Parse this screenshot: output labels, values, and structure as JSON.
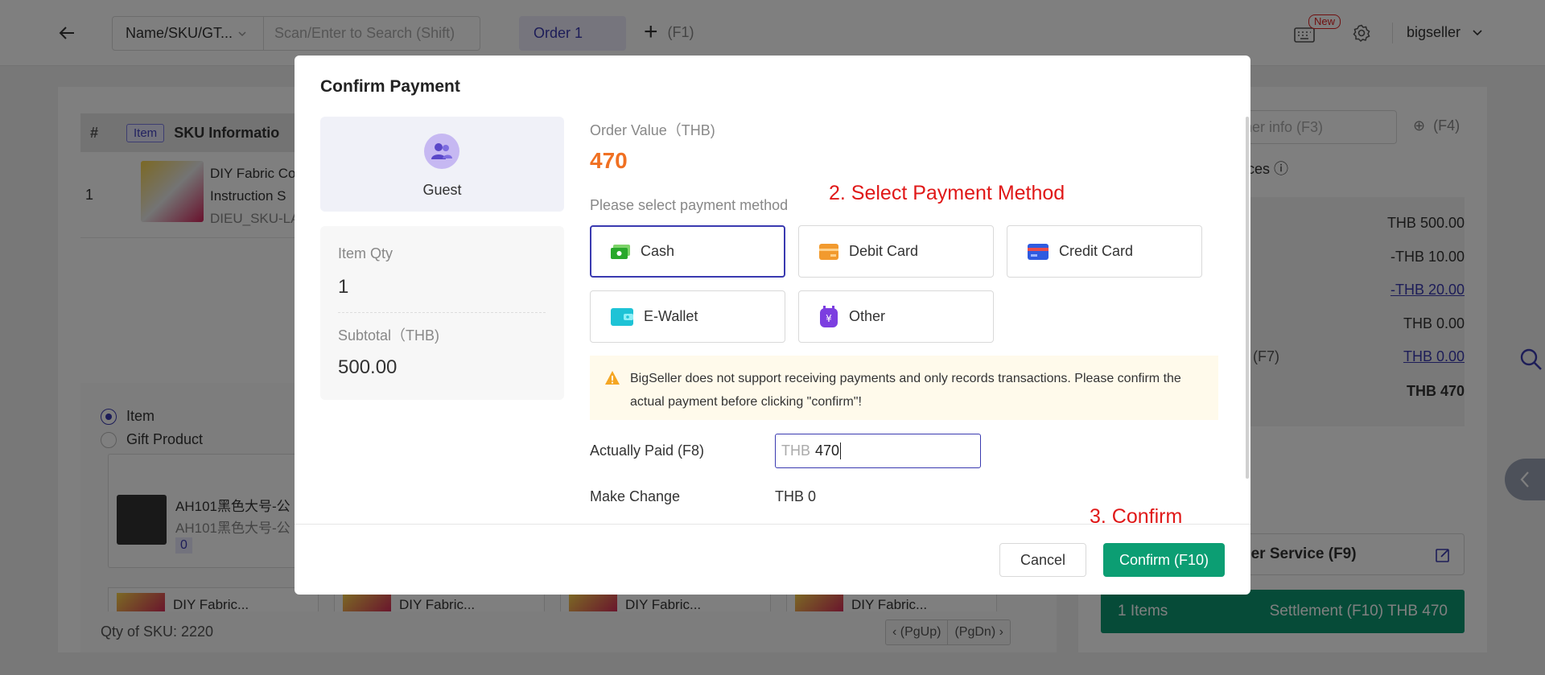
{
  "topbar": {
    "search_type": "Name/SKU/GT...",
    "search_placeholder": "Scan/Enter to Search (Shift)",
    "order_tab": "Order 1",
    "add_order_shortcut": "(F1)",
    "new_badge": "New",
    "username": "bigseller"
  },
  "table": {
    "hash": "#",
    "item_tag": "Item",
    "sku_header": "SKU Informatio",
    "row_number": "1",
    "product_name_1": "DIY Fabric Co",
    "product_name_2": "Instruction S",
    "product_sku": "DIEU_SKU-LA"
  },
  "product_panel": {
    "radio_item": "Item",
    "radio_gift": "Gift Product",
    "card_title": "AH101黑色大号-公",
    "card_subtitle": "AH101黑色大号-公",
    "card_qty": "0",
    "mini_cards": [
      "DIY Fabric...",
      "DIY Fabric...",
      "DIY Fabric...",
      "DIY Fabric..."
    ],
    "qty_of_sku": "Qty of SKU: 2220",
    "pager_up": "(PgUp)",
    "pager_down": "(PgDn)"
  },
  "right_panel": {
    "customer_placeholder": "ner info (F3)",
    "add_shortcut": "(F4)",
    "services_label": "ices",
    "summary": [
      "THB 500.00",
      "-THB 10.00",
      "-THB 20.00",
      "THB 0.00",
      "THB 0.00",
      "THB 470"
    ],
    "f7_label": ") (F7)",
    "service_button": "ner Service (F9)",
    "items_count": "1 Items",
    "settlement": "Settlement (F10) THB 470"
  },
  "modal": {
    "title": "Confirm Payment",
    "customer": "Guest",
    "item_qty_label": "Item Qty",
    "item_qty_value": "1",
    "subtotal_label": "Subtotal（THB)",
    "subtotal_value": "500.00",
    "order_value_label": "Order Value（THB)",
    "order_value": "470",
    "select_method_label": "Please select payment method",
    "annotation_select": "2. Select Payment Method",
    "annotation_confirm": "3. Confirm",
    "payment_methods": [
      "Cash",
      "Debit Card",
      "Credit Card",
      "E-Wallet",
      "Other"
    ],
    "selected_method": "Cash",
    "warning": "BigSeller does not support receiving payments and only records transactions. Please confirm the actual payment before clicking \"confirm\"!",
    "actually_paid_label": "Actually Paid (F8)",
    "paid_currency": "THB",
    "paid_value": "470",
    "make_change_label": "Make Change",
    "make_change_value": "THB 0",
    "cancel_label": "Cancel",
    "confirm_label": "Confirm (F10)"
  },
  "colors": {
    "accent": "#3a3ab0",
    "confirm_green": "#0c9e73",
    "order_value_orange": "#f07022",
    "annotation_red": "#e01818",
    "warning_bg": "#fffaeb"
  }
}
